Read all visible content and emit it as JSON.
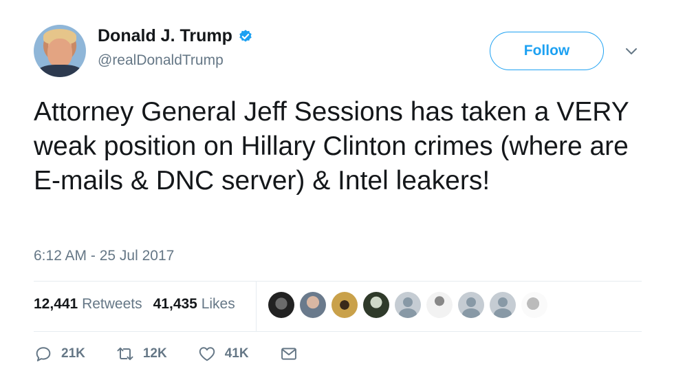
{
  "author": {
    "display_name": "Donald J. Trump",
    "handle": "@realDonaldTrump",
    "verified": true
  },
  "follow_label": "Follow",
  "tweet": {
    "text": "Attorney General Jeff Sessions has taken a VERY weak position on Hillary Clinton crimes (where are E-mails & DNC server) & Intel leakers!",
    "timestamp": "6:12 AM - 25 Jul 2017"
  },
  "stats": {
    "retweets_count": "12,441",
    "retweets_label": "Retweets",
    "likes_count": "41,435",
    "likes_label": "Likes"
  },
  "actions": {
    "reply_count": "21K",
    "retweet_count": "12K",
    "like_count": "41K"
  },
  "colors": {
    "accent": "#1da1f2",
    "secondary_text": "#657786",
    "primary_text": "#14171a",
    "divider": "#e6ecf0"
  }
}
